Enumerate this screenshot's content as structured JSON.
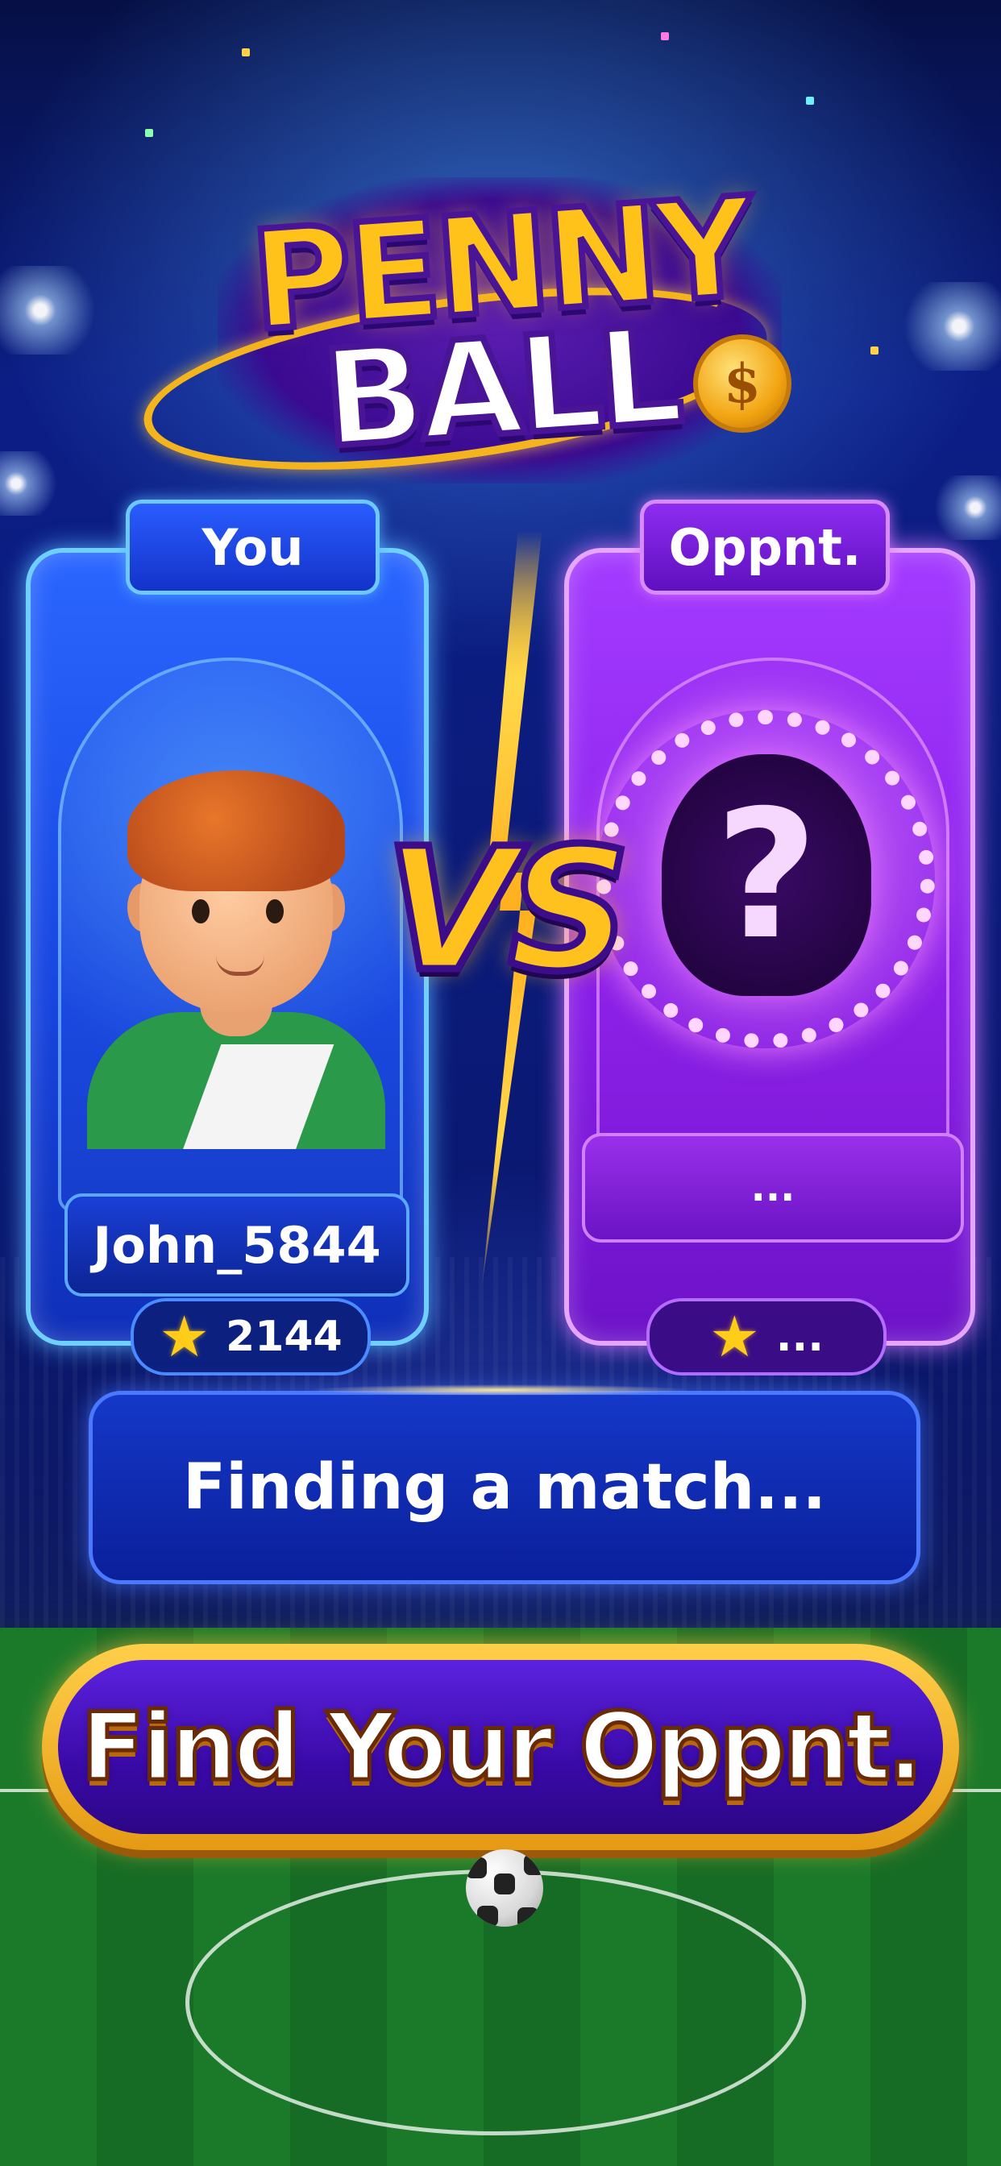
{
  "logo": {
    "line1": "PENNY",
    "line2": "BALL",
    "coin_symbol": "$"
  },
  "player": {
    "tag": "You",
    "username": "John_5844",
    "score": "2144",
    "score_icon": "star-icon"
  },
  "opponent": {
    "tag": "Oppnt.",
    "username": "...",
    "score": "...",
    "score_icon": "star-icon",
    "avatar_placeholder": "?"
  },
  "versus": "VS",
  "status": {
    "text": "Finding a match..."
  },
  "cta": {
    "label": "Find Your Oppnt."
  },
  "colors": {
    "player_accent": "#1f55f0",
    "opponent_accent": "#9a2cf2",
    "gold": "#ffc11e",
    "star": "#ffcc1a"
  }
}
